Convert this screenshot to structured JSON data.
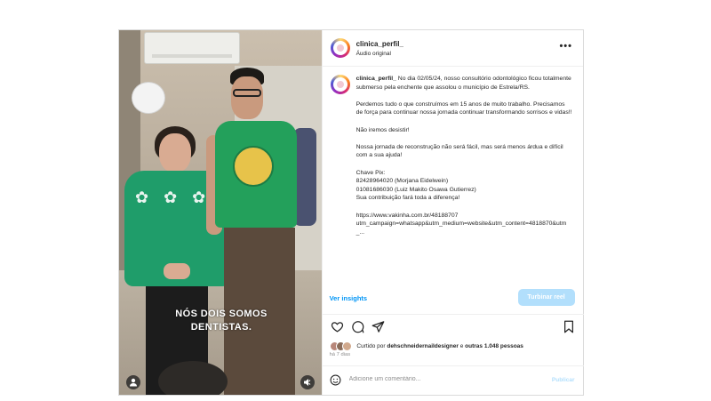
{
  "media": {
    "caption_overlay": "NÓS DOIS SOMOS\nDENTISTAS.",
    "user_tag_icon": "person-icon",
    "audio_icon": "speaker-icon"
  },
  "header": {
    "username": "clinica_perfil_",
    "subtitle": "Áudio original",
    "more_icon": "more-horizontal-icon",
    "more_label": "•••"
  },
  "post": {
    "username": "clinica_perfil_",
    "paragraphs": [
      "No dia 02/05/24, nosso consultório odontológico ficou totalmente submerso pela enchente que assolou o município de Estrela/RS.",
      "Perdemos tudo o que construímos em 15 anos de muito trabalho. Precisamos de força para continuar nossa jornada continuar transformando sorrisos e vidas!!",
      "Não iremos desistir!",
      "Nossa jornada de reconstrução não será fácil, mas será menos árdua e difícil com a sua ajuda!",
      "Chave Pix:\n82428964020 (Morjana Eidelwein)\n01081686030 (Luiz Makito Osawa Gutierrez)\nSua contribuição fará toda a diferença!",
      "https://www.vakinha.com.br/48188707\nutm_campaign=whatsapp&utm_medium=website&utm_content=4818870&utm_..."
    ]
  },
  "insights": {
    "view_label": "Ver insights",
    "boost_label": "Turbinar reel"
  },
  "actions": {
    "like_icon": "heart-icon",
    "comment_icon": "comment-icon",
    "share_icon": "send-icon",
    "save_icon": "bookmark-icon"
  },
  "likes": {
    "prefix": "Curtido por",
    "user": "dehschneidernaildesigner",
    "connector": "e",
    "others": "outras 1.048 pessoas"
  },
  "timestamp": "há 7 dias",
  "comment": {
    "emoji_icon": "emoji-icon",
    "placeholder": "Adicione um comentário...",
    "publish_label": "Publicar"
  },
  "colors": {
    "link_blue": "#0095f6",
    "boost_bg": "#b2dffc",
    "border": "#dbdbdb"
  }
}
